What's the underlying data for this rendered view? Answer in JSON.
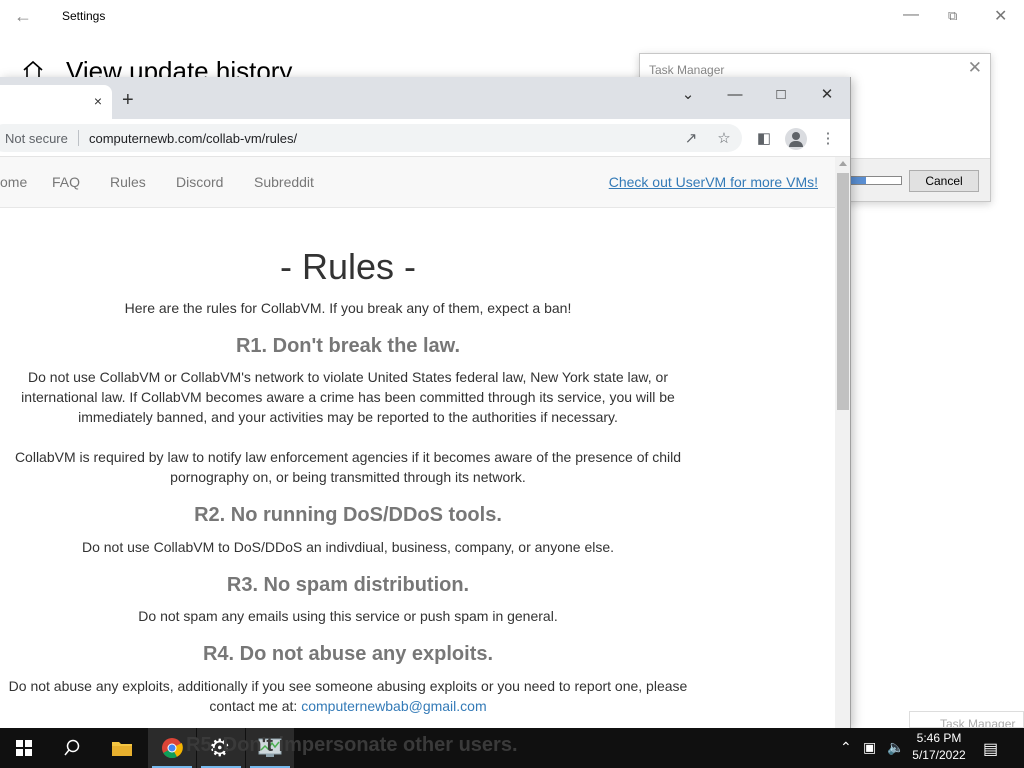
{
  "settings": {
    "title": "Settings",
    "page_heading": "View update history"
  },
  "task_manager": {
    "title": "Task Manager",
    "cancel_label": "Cancel",
    "progress": 0.3
  },
  "browser": {
    "security_label": "Not secure",
    "url": "computernewb.com/collab-vm/rules/",
    "new_tab_label": "+",
    "tab_close": "×"
  },
  "site_nav": {
    "items": [
      "ome",
      "FAQ",
      "Rules",
      "Discord",
      "Subreddit"
    ],
    "promo": "Check out UserVM for more VMs!"
  },
  "rules_page": {
    "title": "- Rules -",
    "intro": "Here are the rules for CollabVM. If you break any of them, expect a ban!",
    "r1_heading": "R1. Don't break the law.",
    "r1_p1": "Do not use CollabVM or CollabVM's network to violate United States federal law, New York state law, or international law. If CollabVM becomes aware a crime has been committed through its service, you will be immediately banned, and your activities may be reported to the authorities if necessary.",
    "r1_p2": "CollabVM is required by law to notify law enforcement agencies if it becomes aware of the presence of child pornography on, or being transmitted through its network.",
    "r2_heading": "R2. No running DoS/DDoS tools.",
    "r2_p": "Do not use CollabVM to DoS/DDoS an indivdiual, business, company, or anyone else.",
    "r3_heading": "R3. No spam distribution.",
    "r3_p": "Do not spam any emails using this service or push spam in general.",
    "r4_heading": "R4. Do not abuse any exploits.",
    "r4_p": "Do not abuse any exploits, additionally if you see someone abusing exploits or you need to report one, please contact me at:",
    "r4_email": "computernewbab@gmail.com",
    "r5_heading": "R5. Don't impersonate other users."
  },
  "notification_peek": "Task Manager",
  "taskbar": {
    "time": "5:46 PM",
    "date": "5/17/2022"
  }
}
